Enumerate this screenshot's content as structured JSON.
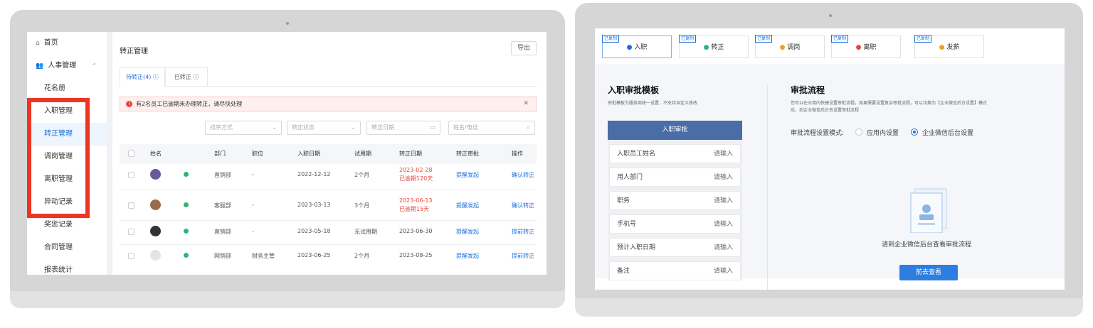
{
  "left_app": {
    "sidebar": {
      "home": "首页",
      "hr_group": "人事管理",
      "items": [
        "花名册",
        "入职管理",
        "转正管理",
        "调岗管理",
        "离职管理",
        "异动记录",
        "奖惩记录",
        "合同管理",
        "报表统计"
      ]
    },
    "page_title": "转正管理",
    "export_label": "导出",
    "tabs": [
      "待转正(4) ⓘ",
      "已转正 ⓘ"
    ],
    "alert": "有2名员工已逾期未办理转正，请尽快处理",
    "filters": {
      "sort": "排序方式",
      "status": "转正状态",
      "date": "转正日期",
      "search": "姓名/电话"
    },
    "columns": [
      "姓名",
      "部门",
      "职位",
      "入职日期",
      "试用期",
      "转正日期",
      "转正审批",
      "操作"
    ],
    "rows": [
      {
        "dept": "直销部",
        "position": "-",
        "join": "2022-12-12",
        "probation": "2个月",
        "regular": "2023-02-28",
        "overdue": "已逾期120天",
        "approval": "提醒发起",
        "action": "确认转正"
      },
      {
        "dept": "客服部",
        "position": "-",
        "join": "2023-03-13",
        "probation": "3个月",
        "regular": "2023-06-13",
        "overdue": "已逾期15天",
        "approval": "提醒发起",
        "action": "确认转正"
      },
      {
        "dept": "直销部",
        "position": "-",
        "join": "2023-05-18",
        "probation": "无试用期",
        "regular": "2023-06-30",
        "overdue": "",
        "approval": "提醒发起",
        "action": "提前转正"
      },
      {
        "dept": "网销部",
        "position": "财务主管",
        "join": "2023-06-25",
        "probation": "2个月",
        "regular": "2023-08-25",
        "overdue": "",
        "approval": "提醒发起",
        "action": "提前转正"
      }
    ]
  },
  "right_app": {
    "badge": "已复制",
    "tabs": [
      "入职",
      "转正",
      "调岗",
      "离职",
      "发薪"
    ],
    "template_title": "入职审批模板",
    "template_sub": "审批模板为服务商统一设置，不支持自定义修改",
    "form_header": "入职审批",
    "form_fields": [
      "入职员工姓名",
      "用人部门",
      "职务",
      "手机号",
      "预计入职日期",
      "备注"
    ],
    "placeholder": "请输入",
    "flow_title": "审批流程",
    "flow_sub_1": "您可以在应用内快捷设置审批流程，如果需要设置复杂审批流程，可以切换为【企业微信后台设置】模式",
    "flow_sub_2": "后，到企业微信后台去设置审批流程",
    "mode_label": "审批流程设置模式:",
    "mode_options": [
      "应用内设置",
      "企业微信后台设置"
    ],
    "empty_text": "请到企业微信后台查看审批流程",
    "go_button": "前去查看"
  },
  "colors": {
    "accent": "#1e6fd9",
    "highlight_box": "#ee3524",
    "form_header": "#4a6da7",
    "overdue": "#e7463a"
  }
}
